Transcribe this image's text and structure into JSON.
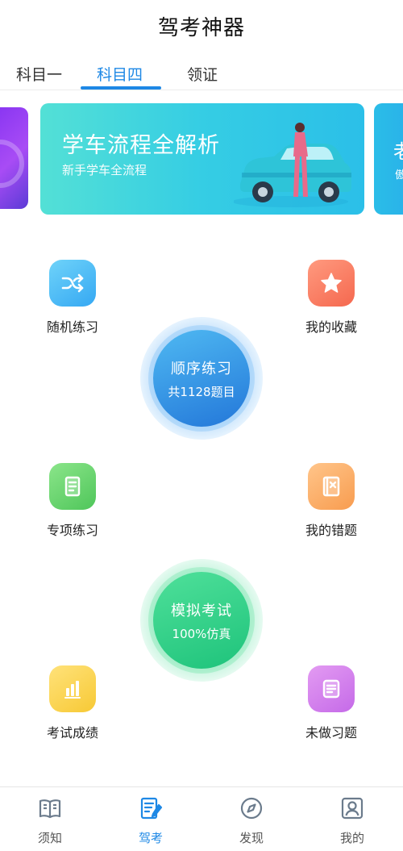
{
  "header": {
    "title": "驾考神器"
  },
  "tabs": [
    {
      "label": "科目一",
      "active": false
    },
    {
      "label": "科目四",
      "active": true
    },
    {
      "label": "领证",
      "active": false
    }
  ],
  "banner": {
    "title": "学车流程全解析",
    "subtitle": "新手学车全流程",
    "peek_right_title": "老",
    "peek_right_sub": "傲"
  },
  "features": {
    "random": {
      "label": "随机练习",
      "icon": "shuffle-icon"
    },
    "favorites": {
      "label": "我的收藏",
      "icon": "star-icon"
    },
    "topic": {
      "label": "专项练习",
      "icon": "scroll-icon"
    },
    "wrong": {
      "label": "我的错题",
      "icon": "wrong-book-icon"
    },
    "scores": {
      "label": "考试成绩",
      "icon": "bar-chart-icon"
    },
    "undone": {
      "label": "未做习题",
      "icon": "note-icon"
    }
  },
  "sequential": {
    "label": "顺序练习",
    "count": "共1128题目"
  },
  "mock_exam": {
    "label": "模拟考试",
    "sub": "100%仿真"
  },
  "bottom_nav": [
    {
      "label": "须知",
      "icon": "book-icon",
      "active": false
    },
    {
      "label": "驾考",
      "icon": "exam-doc-icon",
      "active": true
    },
    {
      "label": "发现",
      "icon": "compass-icon",
      "active": false
    },
    {
      "label": "我的",
      "icon": "profile-icon",
      "active": false
    }
  ],
  "colors": {
    "accent": "#1e88e5",
    "nav_inactive": "#555555"
  }
}
